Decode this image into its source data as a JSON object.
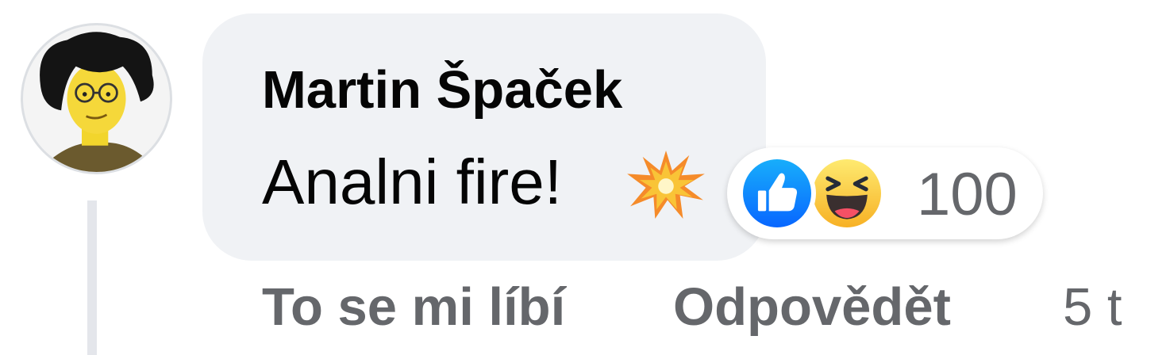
{
  "comment": {
    "author": "Martin Špaček",
    "text": "Analni fire!",
    "text_emoji_icon": "collision-icon",
    "avatar_icon": "cartoon-avatar"
  },
  "reactions": {
    "icons": [
      "like-icon",
      "haha-icon"
    ],
    "count": "100",
    "colors": {
      "like": "#1877f2",
      "haha": "#f7b125"
    }
  },
  "actions": {
    "like_label": "To se mi líbí",
    "reply_label": "Odpovědět",
    "timestamp": "5 t"
  },
  "colors": {
    "bubble": "#f0f2f5",
    "text": "#050505",
    "secondary_text": "#65676b",
    "thread_line": "#e4e6eb"
  }
}
